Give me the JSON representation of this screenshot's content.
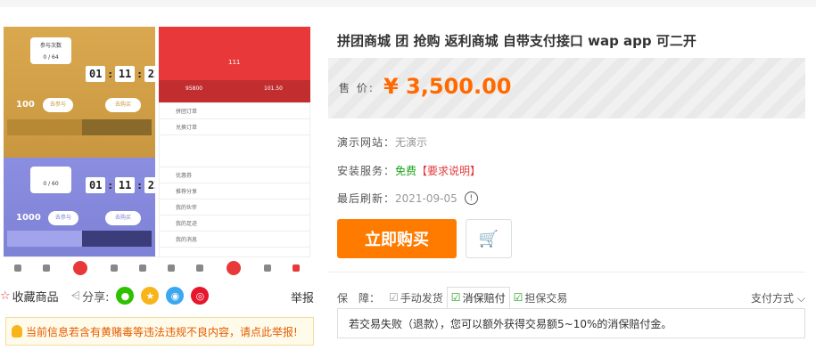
{
  "gallery": {
    "gold_panel": {
      "join_label": "参与次数",
      "join_count": "0 / 64",
      "timer": [
        "01",
        "11",
        "22"
      ],
      "price": "100",
      "btn_join": "去参与",
      "btn_buy": "去购买"
    },
    "purple_panel": {
      "join_count": "0 / 60",
      "timer": [
        "01",
        "11",
        "22"
      ],
      "price": "1000",
      "btn_join": "去参与",
      "btn_buy": "去购买"
    },
    "red_panel": {
      "number": "111",
      "left_value": "95800",
      "right_value": "101.50"
    },
    "list_rows": [
      "拼团订单",
      "兑换订单",
      "优惠券",
      "推荐分享",
      "我的伙伴",
      "我的足迹",
      "我的消息"
    ]
  },
  "share": {
    "fav_label": "收藏商品",
    "share_label": "分享:",
    "report_label": "举报"
  },
  "notice": {
    "text": "当前信息若含有黄赌毒等违法违规不良内容，请点此举报!"
  },
  "product": {
    "title": "拼团商城 团 抢购 返利商城 自带支付接口 wap app 可二开",
    "price_label": "售 价:",
    "price": "¥ 3,500.00",
    "demo_label": "演示网站：",
    "demo_value": "无演示",
    "install_label": "安装服务：",
    "install_value": "免费",
    "install_link": "【要求说明】",
    "refresh_label": "最后刷新：",
    "refresh_value": "2021-09-05",
    "buy_label": "立即购买",
    "cart_icon": "cart-icon"
  },
  "guarantee": {
    "label": "保　障：",
    "tabs": [
      "手动发货",
      "消保赔付",
      "担保交易"
    ],
    "active_tab": 1,
    "pay_method": "支付方式",
    "description": "若交易失败（退款），您可以额外获得交易额5~10%的消保赔付金。"
  },
  "colors": {
    "accent": "#ff7b00",
    "price": "#ff6a00",
    "red": "#e4393c",
    "green": "#1aa31a"
  }
}
